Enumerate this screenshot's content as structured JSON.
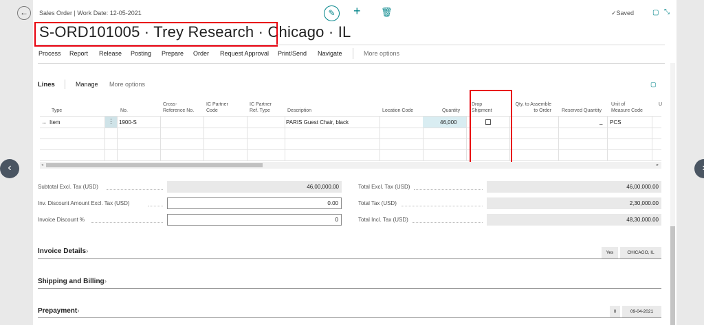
{
  "header": {
    "breadcrumb": "Sales Order | Work Date: 12-05-2021",
    "saved_label": "Saved",
    "title": "S-ORD101005 · Trey Research · Chicago · IL"
  },
  "actions": [
    "Process",
    "Report",
    "Release",
    "Posting",
    "Prepare",
    "Order",
    "Request Approval",
    "Print/Send",
    "Navigate"
  ],
  "more_options": "More options",
  "lines": {
    "title": "Lines",
    "manage": "Manage",
    "more_options": "More options",
    "columns": {
      "type": "Type",
      "no": "No.",
      "cross_ref_1": "Cross-",
      "cross_ref_2": "Reference No.",
      "ic_partner_code_1": "IC Partner",
      "ic_partner_code_2": "Code",
      "ic_partner_ref_1": "IC Partner",
      "ic_partner_ref_2": "Ref. Type",
      "description": "Description",
      "location_code": "Location Code",
      "quantity": "Quantity",
      "drop_shipment_1": "Drop",
      "drop_shipment_2": "Shipment",
      "qty_assemble_1": "Qty. to Assemble",
      "qty_assemble_2": "to Order",
      "reserved_quantity": "Reserved Quantity",
      "unit_measure_1": "Unit of",
      "unit_measure_2": "Measure Code",
      "clipped": "U"
    },
    "row": {
      "type": "Item",
      "no": "1900-S",
      "description": "PARIS Guest Chair, black",
      "quantity": "46,000",
      "reserved": "_",
      "unit": "PCS"
    }
  },
  "totals": {
    "subtotal_label": "Subtotal Excl. Tax (USD)",
    "subtotal_value": "46,00,000.00",
    "inv_discount_label": "Inv. Discount Amount Excl. Tax (USD)",
    "inv_discount_value": "0.00",
    "invoice_discount_pct_label": "Invoice Discount %",
    "invoice_discount_pct_value": "0",
    "total_excl_label": "Total Excl. Tax (USD)",
    "total_excl_value": "46,00,000.00",
    "total_tax_label": "Total Tax (USD)",
    "total_tax_value": "2,30,000.00",
    "total_incl_label": "Total Incl. Tax (USD)",
    "total_incl_value": "48,30,000.00"
  },
  "sections": {
    "invoice_details": "Invoice Details",
    "invoice_tag_1": "Yes",
    "invoice_tag_2": "CHICAGO, IL",
    "shipping_billing": "Shipping and Billing",
    "prepayment": "Prepayment",
    "prepayment_tag_1": "0",
    "prepayment_tag_2": "09-04-2021"
  },
  "icons": [
    "back-arrow-icon",
    "edit-pencil-icon",
    "plus-icon",
    "trash-icon",
    "check-icon",
    "open-new-window-icon",
    "collapse-icon",
    "chevron-left-icon",
    "chevron-right-icon",
    "row-arrow-icon",
    "ellipsis-icon"
  ],
  "colors": {
    "accent": "#008489",
    "highlight": "#e8000d",
    "quantity_bg": "#d9edf2"
  }
}
